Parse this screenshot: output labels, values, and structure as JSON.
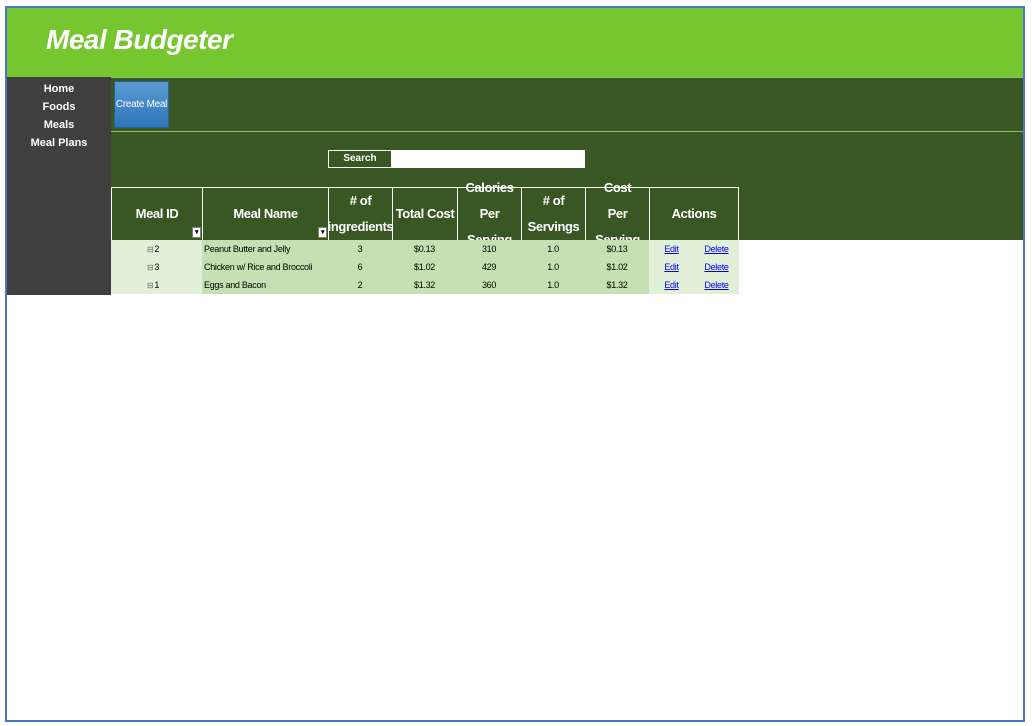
{
  "app": {
    "title": "Meal Budgeter"
  },
  "sidebar": {
    "items": [
      {
        "label": "Home"
      },
      {
        "label": "Foods"
      },
      {
        "label": "Meals"
      },
      {
        "label": "Meal Plans"
      }
    ]
  },
  "toolbar": {
    "create_label": "Create Meal"
  },
  "search": {
    "label": "Search",
    "value": ""
  },
  "table": {
    "headers": {
      "meal_id": "Meal ID",
      "meal_name": "Meal Name",
      "ingredients": "# of ingredients",
      "total_cost": "Total Cost",
      "calories": "Calories Per Serving",
      "servings": "# of Servings",
      "cost_per": "Cost Per Serving",
      "actions": "Actions"
    },
    "rows": [
      {
        "id": "2",
        "name": "Peanut Butter and Jelly",
        "ingredients": "3",
        "total_cost": "$0.13",
        "calories": "310",
        "servings": "1.0",
        "cost_per": "$0.13",
        "edit": "Edit",
        "delete": "Delete"
      },
      {
        "id": "3",
        "name": "Chicken w/ Rice and Broccoli",
        "ingredients": "6",
        "total_cost": "$1.02",
        "calories": "429",
        "servings": "1.0",
        "cost_per": "$1.02",
        "edit": "Edit",
        "delete": "Delete"
      },
      {
        "id": "1",
        "name": "Eggs and Bacon",
        "ingredients": "2",
        "total_cost": "$1.32",
        "calories": "360",
        "servings": "1.0",
        "cost_per": "$1.32",
        "edit": "Edit",
        "delete": "Delete"
      }
    ]
  },
  "colors": {
    "header_bg": "#76c72f",
    "dark_green": "#385723",
    "sidebar_bg": "#3f3f3f",
    "row_light": "#e2efd9",
    "row_mid": "#c6e0b4",
    "button_blue": "#2e75b6"
  },
  "icons": {
    "filter": "filter-dropdown-icon",
    "expand": "collapse-minus-icon"
  }
}
